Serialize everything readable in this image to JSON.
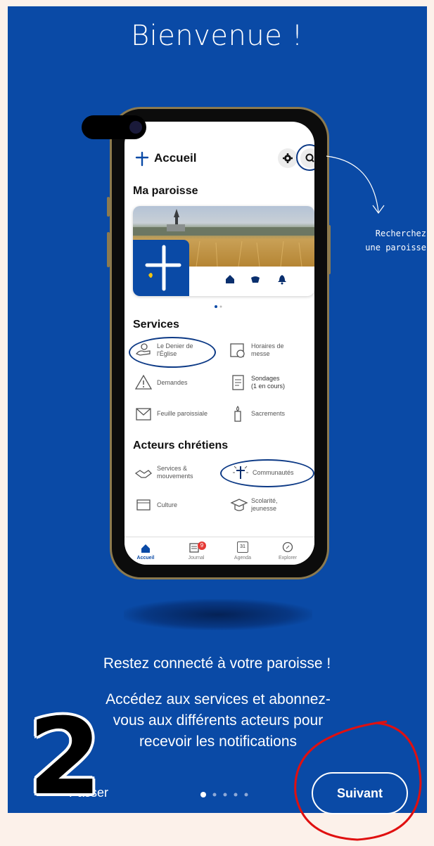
{
  "header": {
    "title": "Bienvenue !"
  },
  "phone": {
    "screen_title": "Accueil",
    "section_parish": "Ma paroisse",
    "section_parish_next": "M",
    "section_services": "Services",
    "services": [
      {
        "label_line1": "Le Denier de",
        "label_line2": "l'Église",
        "icon": "donation-hands-icon"
      },
      {
        "label_line1": "Horaires de",
        "label_line2": "messe",
        "icon": "calendar-clock-icon"
      },
      {
        "label_line1": "Demandes",
        "label_line2": "",
        "icon": "warning-triangle-icon"
      },
      {
        "label_line1": "Sondages",
        "label_line2": "(1 en cours)",
        "icon": "survey-clipboard-icon"
      },
      {
        "label_line1": "Feuille paroissiale",
        "label_line2": "",
        "icon": "newsletter-envelope-icon"
      },
      {
        "label_line1": "Sacrements",
        "label_line2": "",
        "icon": "candle-icon"
      }
    ],
    "section_actors": "Acteurs chrétiens",
    "actors": [
      {
        "label_line1": "Services &",
        "label_line2": "mouvements",
        "icon": "handshake-icon"
      },
      {
        "label_line1": "Communautés",
        "label_line2": "",
        "icon": "cross-radiant-icon"
      },
      {
        "label_line1": "Culture",
        "label_line2": "",
        "icon": "books-icon"
      },
      {
        "label_line1": "Scolarité,",
        "label_line2": "jeunesse",
        "icon": "graduation-cap-icon"
      }
    ],
    "tabs": [
      {
        "label": "Accueil",
        "icon": "home-icon",
        "active": true
      },
      {
        "label": "Journal",
        "icon": "journal-icon",
        "badge": "9"
      },
      {
        "label": "Agenda",
        "icon": "calendar-icon",
        "day": "31"
      },
      {
        "label": "Explorer",
        "icon": "compass-icon"
      }
    ]
  },
  "annotation": {
    "line1": "Recherchez",
    "line2": "une paroisse"
  },
  "onboarding": {
    "subtitle": "Restez connecté à votre paroisse !",
    "body_line1": "Accédez aux services et abonnez-",
    "body_line2": "vous aux différents acteurs pour",
    "body_line3": "recevoir les notifications",
    "skip_label": "Passer",
    "next_label": "Suivant",
    "page_index": 1,
    "page_count": 5
  },
  "overlay": {
    "step_number": "2"
  },
  "colors": {
    "brand_blue": "#0a4aa6",
    "annotation_red": "#e01010",
    "background": "#fcf1ea"
  }
}
